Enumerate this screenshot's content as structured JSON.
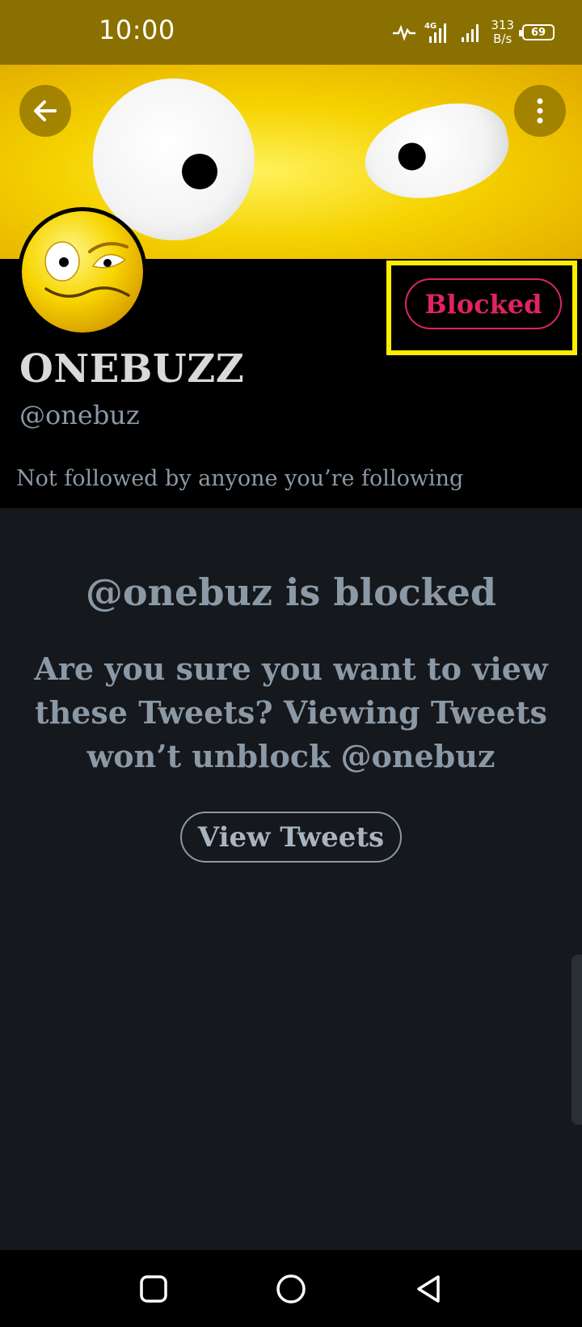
{
  "status_bar": {
    "time": "10:00",
    "network_type": "4G",
    "net_speed_value": "313",
    "net_speed_unit": "B/s",
    "battery": "69"
  },
  "header": {
    "back_icon": "arrow-left-icon",
    "more_icon": "more-vertical-icon"
  },
  "profile": {
    "display_name": "ONEBUZZ",
    "handle": "@onebuz",
    "followers_note": "Not followed by anyone you’re following",
    "blocked_label": "Blocked"
  },
  "notice": {
    "title": "@onebuz is blocked",
    "body": "Are you sure you want to view these Tweets? Viewing Tweets won’t unblock @onebuz",
    "button_label": "View Tweets"
  },
  "colors": {
    "status_bar_bg": "#8a7000",
    "blocked_accent": "#e0245e",
    "highlight_border": "#ffee00",
    "page_bg": "#15181c",
    "muted_text": "#8b98a5"
  }
}
